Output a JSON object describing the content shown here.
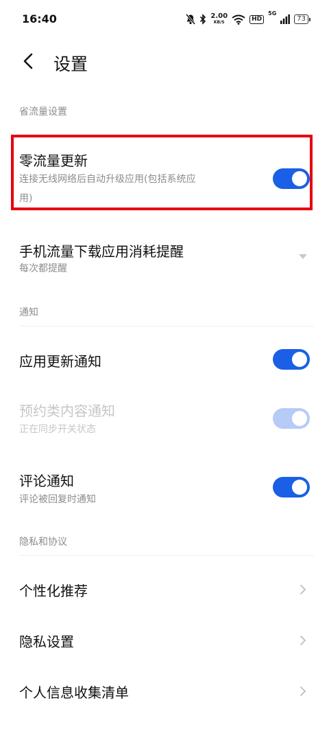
{
  "status_bar": {
    "time": "16:40",
    "net_rate_value": "2.00",
    "net_rate_unit": "KB/S",
    "hd_label": "HD",
    "signal_label": "5G",
    "battery": "73"
  },
  "header": {
    "title": "设置"
  },
  "sections": {
    "data_saving": "省流量设置",
    "notifications": "通知",
    "privacy": "隐私和协议"
  },
  "zero_data_update": {
    "title": "零流量更新",
    "subtitle_line1": "连接无线网络后自动升级应用(包括系统应",
    "subtitle_line2": "用)",
    "enabled": true
  },
  "mobile_data_reminder": {
    "title": "手机流量下载应用消耗提醒",
    "value": "每次都提醒"
  },
  "app_update_notice": {
    "title": "应用更新通知",
    "enabled": true
  },
  "reservation_notice": {
    "title": "预约类内容通知",
    "subtitle": "正在同步开关状态",
    "enabled": true,
    "disabled": true
  },
  "comment_notice": {
    "title": "评论通知",
    "subtitle": "评论被回复时通知",
    "enabled": true
  },
  "privacy_items": [
    {
      "label": "个性化推荐"
    },
    {
      "label": "隐私设置"
    },
    {
      "label": "个人信息收集清单"
    }
  ],
  "colors": {
    "accent": "#1a5fe6",
    "highlight_border": "#e8000d"
  }
}
